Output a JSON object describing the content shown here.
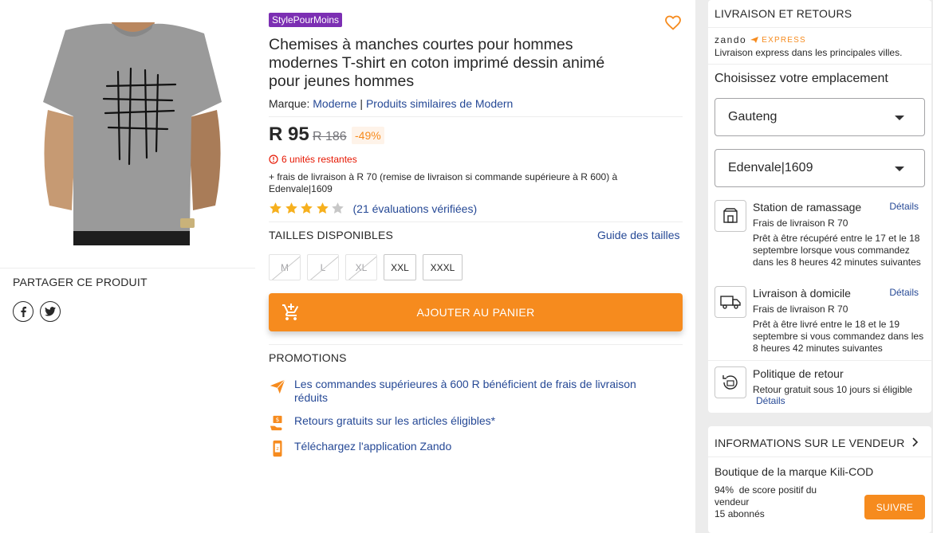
{
  "product": {
    "brand_badge": "StylePourMoins",
    "title": "Chemises à manches courtes pour hommes modernes T-shirt en coton imprimé dessin animé pour jeunes hommes",
    "brand_label": "Marque: ",
    "brand_name": "Moderne",
    "brand_sep": " | ",
    "similar_link": "Produits similaires de Modern",
    "price": "R 95",
    "old_price": "R 186",
    "discount": "-49%",
    "stock_text": "6 unités restantes",
    "shipping_prefix": "+ frais de livraison à ",
    "shipping_amount": "R 70",
    "shipping_suffix": " (remise de livraison si commande supérieure à R 600) à Edenvale|1609",
    "rating_stars": 4,
    "rating_max": 5,
    "rating_text": "(21 évaluations vérifiées)",
    "sizes_title": "TAILLES DISPONIBLES",
    "size_guide": "Guide des tailles",
    "sizes": [
      {
        "label": "M",
        "available": false
      },
      {
        "label": "L",
        "available": false
      },
      {
        "label": "XL",
        "available": false
      },
      {
        "label": "XXL",
        "available": true
      },
      {
        "label": "XXXL",
        "available": true
      }
    ],
    "add_to_cart": "AJOUTER AU PANIER",
    "promotions_title": "PROMOTIONS",
    "promotions": [
      {
        "icon": "paper-plane-icon",
        "text": "Les commandes supérieures à 600 R bénéficient de frais de livraison réduits"
      },
      {
        "icon": "return-box-icon",
        "text": "Retours gratuits sur les articles éligibles*"
      },
      {
        "icon": "phone-app-icon",
        "text": "Téléchargez l'application Zando"
      }
    ]
  },
  "share": {
    "title": "PARTAGER CE PRODUIT",
    "facebook": "f"
  },
  "delivery": {
    "heading": "LIVRAISON ET RETOURS",
    "logo_text": "zando",
    "logo_express": "EXPRESS",
    "express_text": "Livraison express dans les principales villes.",
    "location_title": "Choisissez votre emplacement",
    "region": "Gauteng",
    "city": "Edenvale|1609",
    "options": [
      {
        "icon": "pickup-station-icon",
        "title": "Station de ramassage",
        "link": "Détails",
        "fee_label": "Frais de livraison ",
        "fee": "R 70",
        "desc": "Prêt à être récupéré entre le 17 et le 18 septembre lorsque vous commandez dans les 8 heures 42 minutes suivantes"
      },
      {
        "icon": "delivery-truck-icon",
        "title": "Livraison à domicile",
        "link": "Détails",
        "fee_label": "Frais de livraison ",
        "fee": "R 70",
        "desc": "Prêt à être livré entre le 18 et le 19 septembre si vous commandez dans les 8 heures 42 minutes suivantes"
      }
    ],
    "return_title": "Politique de retour",
    "return_desc": "Retour gratuit sous 10 jours si éligible",
    "return_link": "Détails"
  },
  "seller": {
    "heading": "INFORMATIONS SUR LE VENDEUR",
    "name": "Boutique de la marque Kili-COD",
    "score_value": "94%",
    "score_label": "de score positif du vendeur",
    "followers_value": "15",
    "followers_label": "abonnés",
    "follow_button": "SUIVRE"
  },
  "colors": {
    "accent": "#f68b1e",
    "link": "#264996",
    "badge": "#7c2fb3",
    "alert": "#e61601"
  }
}
